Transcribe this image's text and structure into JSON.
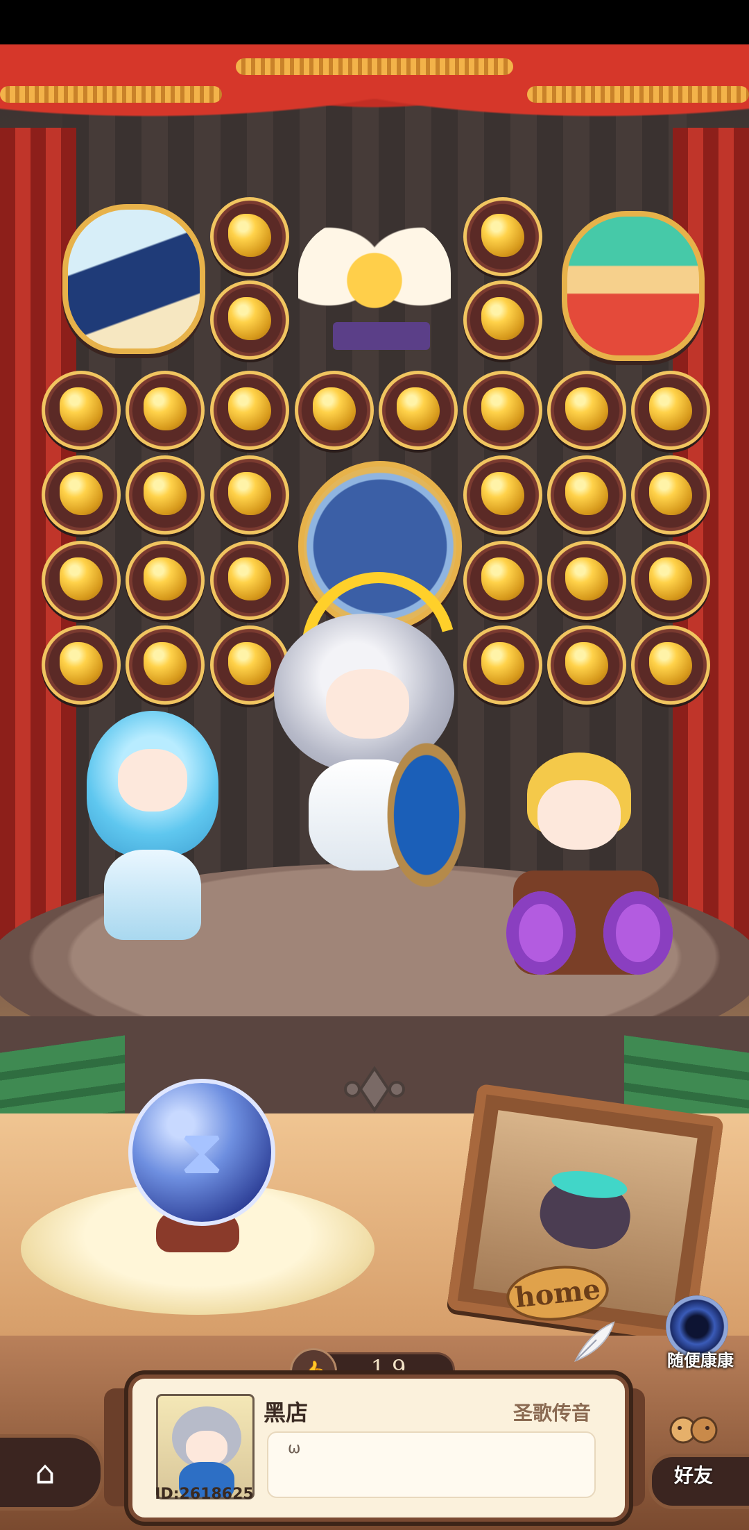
{
  "screen": {
    "title": "stage-room"
  },
  "stage": {
    "home_sign": "home"
  },
  "likes": {
    "count": "19"
  },
  "random_visit": {
    "label": "随便康康"
  },
  "profile": {
    "name": "黑店",
    "title": "圣歌传音",
    "id_label": "ID:2618625",
    "message": "ω"
  },
  "nav": {
    "friends_label": "好友",
    "home_icon": "home-icon"
  },
  "colors": {
    "curtain_red": "#c0352a",
    "gold": "#f1c560",
    "card_bg": "#fbf1dc"
  }
}
